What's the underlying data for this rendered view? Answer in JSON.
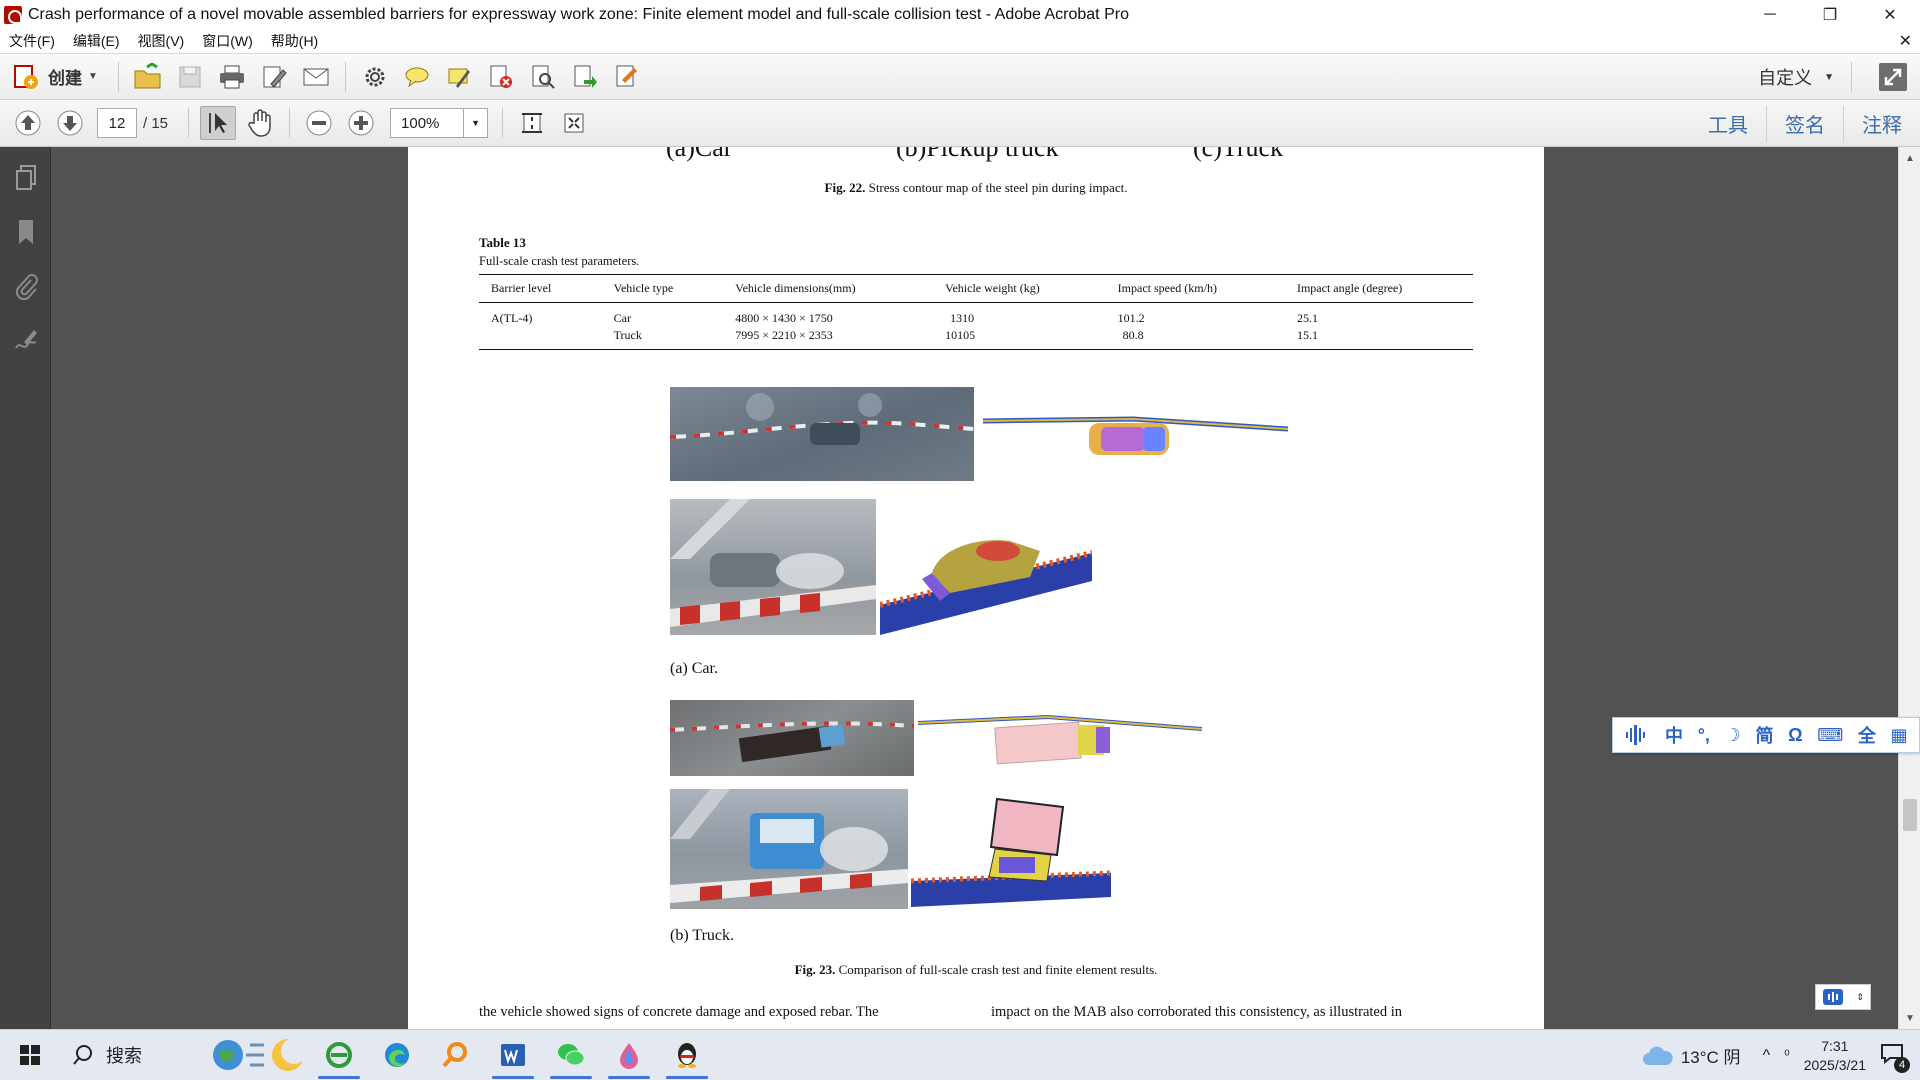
{
  "window": {
    "title": "Crash performance of a novel movable assembled barriers for expressway work zone: Finite element model and full-scale collision test - Adobe Acrobat Pro",
    "minimize": "─",
    "maximize": "❐",
    "close": "✕"
  },
  "menu": {
    "items": [
      "文件(F)",
      "编辑(E)",
      "视图(V)",
      "窗口(W)",
      "帮助(H)"
    ],
    "close": "✕"
  },
  "toolbar": {
    "create_label": "创建",
    "customize_label": "自定义"
  },
  "nav": {
    "current_page": "12",
    "total_pages": "/ 15",
    "zoom": "100%"
  },
  "panels": {
    "tools": "工具",
    "sign": "签名",
    "comment": "注释"
  },
  "document": {
    "fig22_cut_labels": [
      "(a)Car",
      "(b)Pickup truck",
      "(c)Truck"
    ],
    "fig22_caption_label": "Fig. 22.",
    "fig22_caption_text": "Stress contour map of the steel pin during impact.",
    "table_title": "Table 13",
    "table_subtitle": "Full-scale crash test parameters.",
    "table": {
      "headers": [
        "Barrier level",
        "Vehicle type",
        "Vehicle dimensions(mm)",
        "Vehicle weight (kg)",
        "Impact speed (km/h)",
        "Impact angle (degree)"
      ],
      "rows": [
        [
          "A(TL-4)",
          "Car",
          "4800 × 1430 × 1750",
          "1310",
          "101.2",
          "25.1"
        ],
        [
          "",
          "Truck",
          "7995 × 2210 × 2353",
          "10105",
          "80.8",
          "15.1"
        ]
      ]
    },
    "sub_a": "(a) Car.",
    "sub_b": "(b) Truck.",
    "fig23_caption_label": "Fig. 23.",
    "fig23_caption_text": "Comparison of full-scale crash test and finite element results.",
    "body_left": "the vehicle showed signs of concrete damage and exposed rebar. The",
    "body_right": "impact on the MAB also corroborated this consistency, as illustrated in"
  },
  "ime": {
    "items": [
      "中",
      "°,",
      "☽",
      "简",
      "Ω",
      "⌨",
      "全",
      "▦"
    ]
  },
  "taskbar": {
    "search_placeholder": "搜索",
    "weather": "13°C 阴",
    "ime_indicator": "⁰",
    "time": "7:31",
    "date": "2025/3/21",
    "notification_count": "4"
  },
  "colors": {
    "accent": "#3c6ea8",
    "doc_bg": "#525252",
    "leftnav_bg": "#424242",
    "taskbar_bg": "#e4e9f1"
  }
}
